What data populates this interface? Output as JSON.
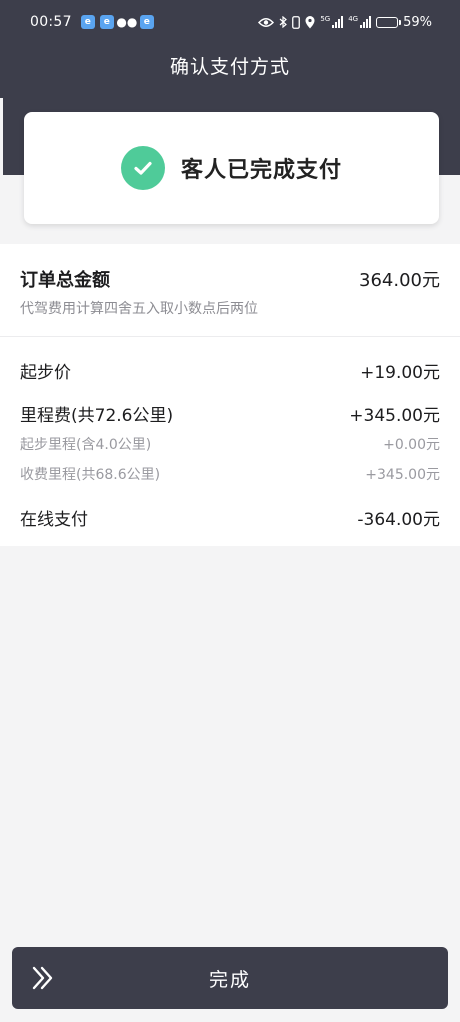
{
  "status_bar": {
    "time": "00:57",
    "app_icons": [
      "browser-icon",
      "browser-icon",
      "wechat-icon",
      "browser-icon"
    ],
    "battery": "59%",
    "signal_tag_1": "5G",
    "signal_tag_2": "4G"
  },
  "header": {
    "title": "确认支付方式"
  },
  "status_card": {
    "message": "客人已完成支付"
  },
  "order": {
    "total_label": "订单总金额",
    "total_value": "364.00元",
    "note": "代驾费用计算四舍五入取小数点后两位",
    "items": [
      {
        "label": "起步价",
        "value": "+19.00元",
        "level": "main"
      },
      {
        "label": "里程费(共72.6公里)",
        "value": "+345.00元",
        "level": "main"
      },
      {
        "label": "起步里程(含4.0公里)",
        "value": "+0.00元",
        "level": "sub"
      },
      {
        "label": "收费里程(共68.6公里)",
        "value": "+345.00元",
        "level": "sub"
      },
      {
        "label": "在线支付",
        "value": "-364.00元",
        "level": "main"
      }
    ]
  },
  "footer": {
    "button_label": "完成"
  },
  "colors": {
    "header_bg": "#3d3e4b",
    "success_green": "#4fcb99",
    "page_bg": "#f4f4f5"
  }
}
